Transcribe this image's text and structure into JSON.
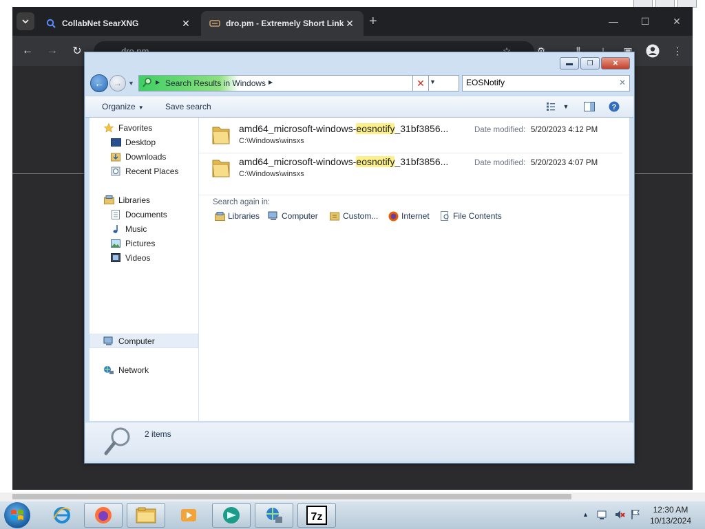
{
  "browser": {
    "tabs": [
      {
        "title": "CollabNet SearXNG",
        "icon": "search-icon",
        "active": false
      },
      {
        "title": "dro.pm - Extremely Short Links",
        "icon": "dropm-icon",
        "active": true
      }
    ],
    "address": "dro.pm"
  },
  "explorer": {
    "breadcrumb": "Search Results in Windows",
    "search_query": "EOSNotify",
    "toolbar": {
      "organize": "Organize",
      "save_search": "Save search"
    },
    "nav": {
      "favorites": "Favorites",
      "desktop": "Desktop",
      "downloads": "Downloads",
      "recent_places": "Recent Places",
      "libraries": "Libraries",
      "documents": "Documents",
      "music": "Music",
      "pictures": "Pictures",
      "videos": "Videos",
      "computer": "Computer",
      "network": "Network"
    },
    "results": [
      {
        "name_prefix": "amd64_microsoft-windows-",
        "name_match": "eosnotify",
        "name_suffix": "_31bf3856...",
        "path": "C:\\Windows\\winsxs",
        "date_label": "Date modified:",
        "date": "5/20/2023 4:12 PM"
      },
      {
        "name_prefix": "amd64_microsoft-windows-",
        "name_match": "eosnotify",
        "name_suffix": "_31bf3856...",
        "path": "C:\\Windows\\winsxs",
        "date_label": "Date modified:",
        "date": "5/20/2023 4:07 PM"
      }
    ],
    "search_again": {
      "label": "Search again in:",
      "libraries": "Libraries",
      "computer": "Computer",
      "custom": "Custom...",
      "internet": "Internet",
      "file_contents": "File Contents"
    },
    "status": "2 items"
  },
  "taskbar": {
    "time": "12:30 AM",
    "date": "10/13/2024"
  }
}
